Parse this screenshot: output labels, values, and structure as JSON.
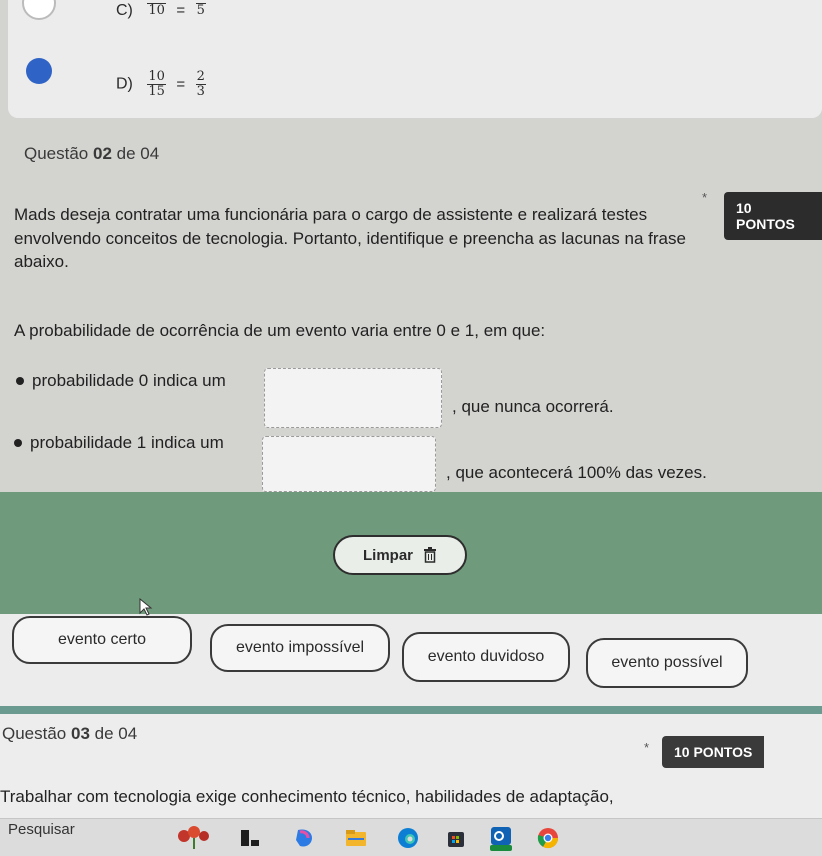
{
  "prev_question": {
    "options": [
      {
        "letter": "C)",
        "num": "10",
        "den": "",
        "eq": "=",
        "rnum": "",
        "rden": "5",
        "selected": false
      },
      {
        "letter": "D)",
        "num": "10",
        "den": "15",
        "eq": "=",
        "rnum": "2",
        "rden": "3",
        "selected": true
      }
    ]
  },
  "question2": {
    "header_prefix": "Questão ",
    "number": "02",
    "header_suffix": " de 04",
    "star": "*",
    "points": "10 PONTOS",
    "text_line1": "Mads deseja contratar uma funcionária para o cargo de assistente e realizará testes",
    "text_line2": "envolvendo conceitos de tecnologia. Portanto, identifique e preencha as lacunas na frase",
    "text_line3": "abaixo.",
    "statement": "A probabilidade de ocorrência de um evento varia entre 0 e 1, em que:",
    "bullets": [
      {
        "before": "probabilidade 0 indica um",
        "after": ", que nunca ocorrerá."
      },
      {
        "before": "probabilidade 1 indica um",
        "after": ", que acontecerá 100% das vezes."
      }
    ],
    "clear_label": "Limpar",
    "choices": [
      "evento certo",
      "evento impossível",
      "evento duvidoso",
      "evento possível"
    ]
  },
  "question3": {
    "header_prefix": "Questão ",
    "number": "03",
    "header_suffix": " de 04",
    "star": "*",
    "points": "10 PONTOS",
    "text": "Trabalhar com tecnologia exige conhecimento técnico, habilidades de adaptação,"
  },
  "taskbar": {
    "search_label": "Pesquisar"
  },
  "colors": {
    "green_bar": "#6f9a7b",
    "radio_selected": "#2f63c6",
    "points_badge": "#2c2c2c"
  }
}
